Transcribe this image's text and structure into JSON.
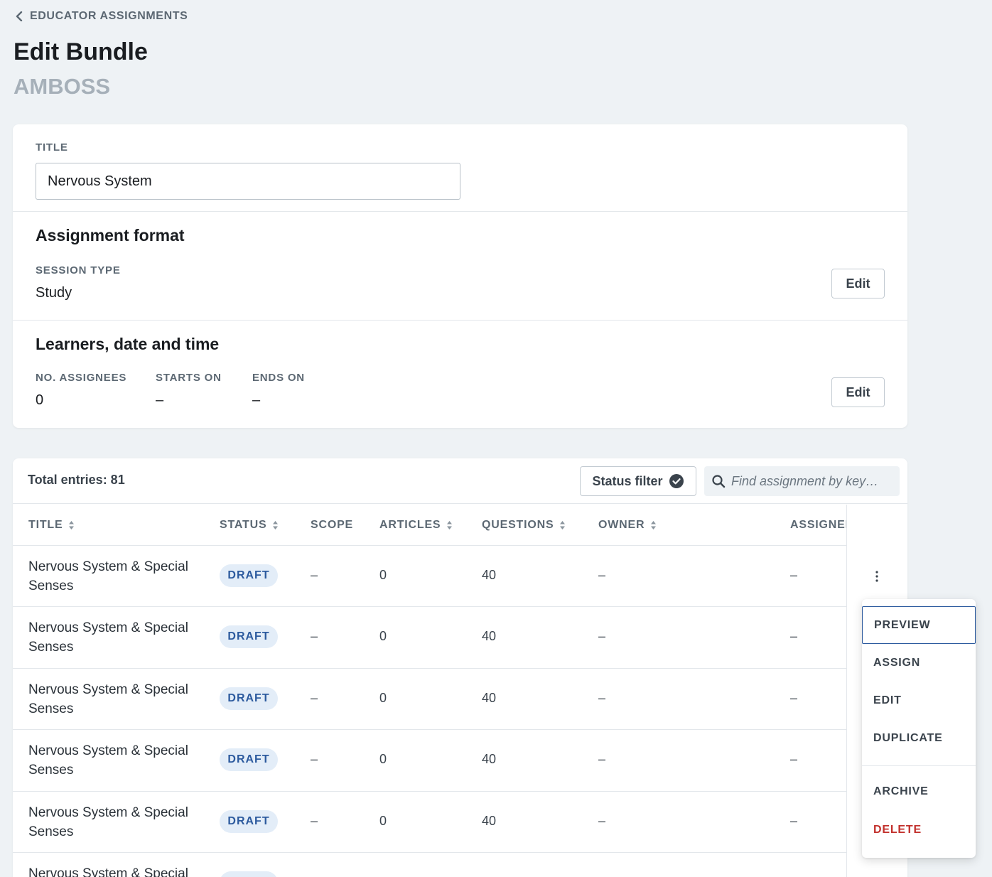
{
  "nav": {
    "back_label": "EDUCATOR ASSIGNMENTS"
  },
  "page": {
    "title": "Edit Bundle",
    "subtitle": "AMBOSS"
  },
  "form": {
    "title_label": "TITLE",
    "title_value": "Nervous System",
    "format": {
      "heading": "Assignment format",
      "session_type_label": "SESSION TYPE",
      "session_type_value": "Study",
      "edit_label": "Edit"
    },
    "learners": {
      "heading": "Learners, date and time",
      "assignees_label": "NO. ASSIGNEES",
      "assignees_value": "0",
      "starts_label": "STARTS ON",
      "starts_value": "–",
      "ends_label": "ENDS ON",
      "ends_value": "–",
      "edit_label": "Edit"
    }
  },
  "table": {
    "total_label": "Total entries: 81",
    "status_filter_label": "Status filter",
    "search_placeholder": "Find assignment by key…",
    "columns": [
      "TITLE",
      "STATUS",
      "SCOPE",
      "ARTICLES",
      "QUESTIONS",
      "OWNER",
      "ASSIGNED"
    ],
    "rows": [
      {
        "title": "Nervous System & Special Senses",
        "status": "DRAFT",
        "scope": "–",
        "articles": "0",
        "questions": "40",
        "owner": "–",
        "assigned": "–"
      },
      {
        "title": "Nervous System & Special Senses",
        "status": "DRAFT",
        "scope": "–",
        "articles": "0",
        "questions": "40",
        "owner": "–",
        "assigned": "–"
      },
      {
        "title": "Nervous System & Special Senses",
        "status": "DRAFT",
        "scope": "–",
        "articles": "0",
        "questions": "40",
        "owner": "–",
        "assigned": "–"
      },
      {
        "title": "Nervous System & Special Senses",
        "status": "DRAFT",
        "scope": "–",
        "articles": "0",
        "questions": "40",
        "owner": "–",
        "assigned": "–"
      },
      {
        "title": "Nervous System & Special Senses",
        "status": "DRAFT",
        "scope": "–",
        "articles": "0",
        "questions": "40",
        "owner": "–",
        "assigned": "–"
      },
      {
        "title": "Nervous System & Special",
        "status": "DRAFT",
        "scope": "",
        "articles": "",
        "questions": "",
        "owner": "",
        "assigned": ""
      }
    ]
  },
  "row_menu": {
    "items": [
      {
        "label": "PREVIEW",
        "focused": true
      },
      {
        "label": "ASSIGN"
      },
      {
        "label": "EDIT"
      },
      {
        "label": "DUPLICATE"
      },
      {
        "label": "ARCHIVE"
      },
      {
        "label": "DELETE",
        "danger": true
      }
    ]
  },
  "colors": {
    "accent": "#2c5a9e",
    "danger": "#c2302c",
    "badge_bg": "#e3edf8",
    "page_bg": "#eef2f5"
  },
  "icons": [
    "chevron-left-icon",
    "check-circle-icon",
    "search-icon",
    "sort-icon",
    "kebab-icon"
  ]
}
